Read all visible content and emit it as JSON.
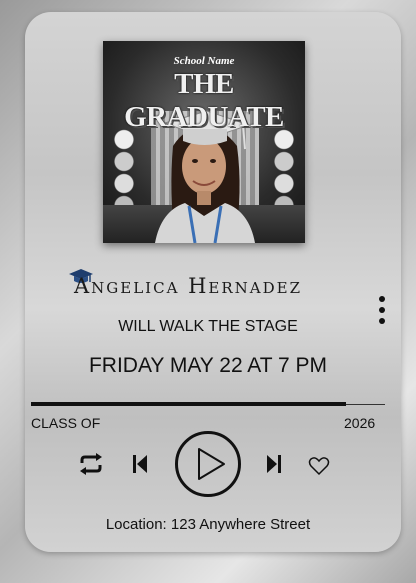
{
  "cover": {
    "school_name": "School Name",
    "title": "THE GRADUATE"
  },
  "graduate": {
    "name": "Angelica Hernadez",
    "icon": "graduation-cap-icon"
  },
  "event": {
    "headline": "WILL WALK THE STAGE",
    "datetime": "FRIDAY MAY 22 AT 7 PM"
  },
  "progress": {
    "fraction": 0.89,
    "left_label": "CLASS OF",
    "right_label": "2026"
  },
  "controls": {
    "repeat": "repeat-icon",
    "previous": "skip-previous-icon",
    "play": "play-icon",
    "next": "skip-next-icon",
    "favorite": "heart-icon",
    "more": "more-vertical-icon"
  },
  "location": "Location: 123 Anywhere Street",
  "colors": {
    "text": "#111111",
    "accent_blue": "#3a6fb5"
  }
}
